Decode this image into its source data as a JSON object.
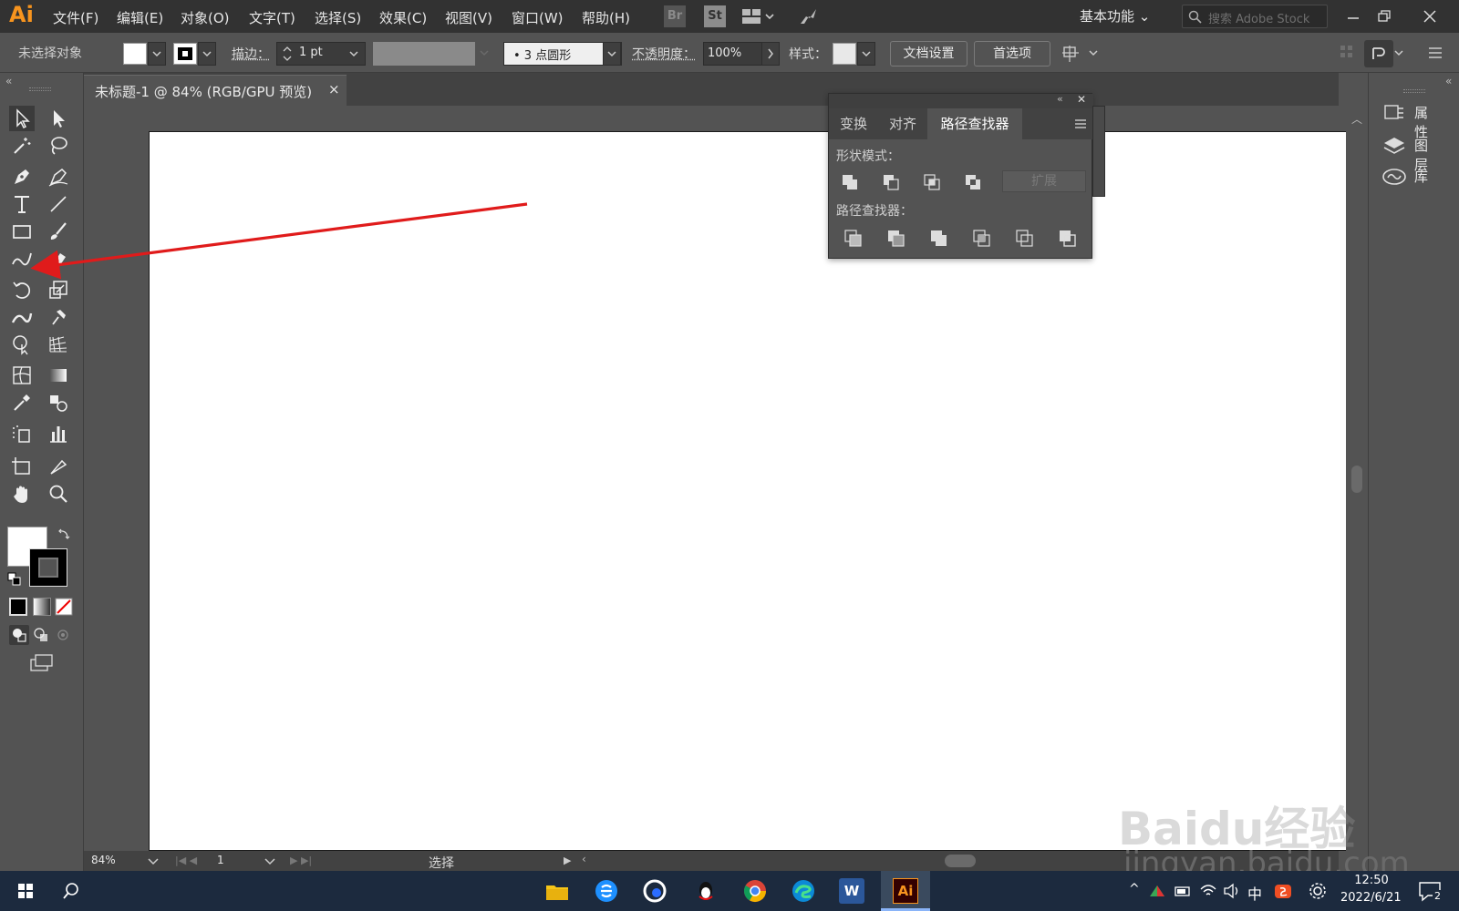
{
  "app": {
    "logo": "Ai",
    "menu": [
      "文件(F)",
      "编辑(E)",
      "对象(O)",
      "文字(T)",
      "选择(S)",
      "效果(C)",
      "视图(V)",
      "窗口(W)",
      "帮助(H)"
    ],
    "bridge_label": "Br",
    "stock_label": "St",
    "workspace": "基本功能",
    "search_placeholder": "搜索 Adobe Stock"
  },
  "control_bar": {
    "selection_status": "未选择对象",
    "stroke_label": "描边：",
    "stroke_value": "1 pt",
    "brush_value": "•  3 点圆形",
    "opacity_label": "不透明度：",
    "opacity_value": "100%",
    "style_label": "样式：",
    "doc_setup_button": "文档设置",
    "preferences_button": "首选项"
  },
  "document": {
    "tab_title": "未标题-1 @ 84% (RGB/GPU 预览)",
    "tab_close": "×"
  },
  "status_bar": {
    "zoom": "84%",
    "page": "1",
    "current_tool": "选择"
  },
  "pathfinder_panel": {
    "tabs": [
      "变换",
      "对齐",
      "路径查找器"
    ],
    "active_tab": "路径查找器",
    "shape_modes_label": "形状模式：",
    "pathfinders_label": "路径查找器：",
    "expand_button": "扩展"
  },
  "right_panel": {
    "items": [
      "属性",
      "图层",
      "库"
    ]
  },
  "taskbar": {
    "time": "12:50",
    "date": "2022/6/21",
    "ime": "中",
    "notification_count": "2",
    "word_label": "W",
    "ai_label": "Ai"
  },
  "watermark": {
    "logo": "Baidu经验",
    "url": "jingyan.baidu.com"
  },
  "colors": {
    "ui_dark": "#323232",
    "ui_mid": "#535353",
    "ai_orange": "#f7941e",
    "annotation_arrow": "#e01b1b"
  }
}
